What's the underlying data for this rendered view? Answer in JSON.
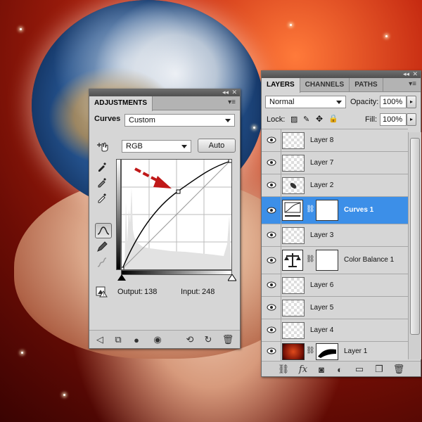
{
  "adjustments": {
    "tab_label": "ADJUSTMENTS",
    "preset_label": "Curves",
    "preset_value": "Custom",
    "channel_value": "RGB",
    "auto_label": "Auto",
    "output_label": "Output:",
    "output_value": "138",
    "input_label": "Input:",
    "input_value": "248",
    "curve_point": {
      "input": 248,
      "output": 138
    }
  },
  "layers_panel": {
    "tabs": [
      "LAYERS",
      "CHANNELS",
      "PATHS"
    ],
    "blend_mode": "Normal",
    "opacity_label": "Opacity:",
    "opacity_value": "100%",
    "lock_label": "Lock:",
    "fill_label": "Fill:",
    "fill_value": "100%",
    "layers": [
      {
        "name": "Layer 8"
      },
      {
        "name": "Layer 7"
      },
      {
        "name": "Layer 2"
      },
      {
        "name": "Curves 1"
      },
      {
        "name": "Layer 3"
      },
      {
        "name": "Color Balance 1"
      },
      {
        "name": "Layer 6"
      },
      {
        "name": "Layer 5"
      },
      {
        "name": "Layer 4"
      },
      {
        "name": "Layer 1"
      }
    ]
  },
  "colors": {
    "selection": "#3c8fe8",
    "arrow": "#c01818",
    "panel": "#d6d6d6"
  }
}
